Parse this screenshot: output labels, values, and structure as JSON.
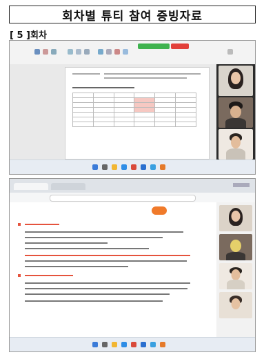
{
  "title": "회차별 튜티 참여 증빙자료",
  "session_label": "[ 5 ]회차",
  "screenshot1": {
    "label": "Document editing session with video call participants",
    "participants": 3
  },
  "screenshot2": {
    "label": "Browser lecture slides with video call participants",
    "participants": 4
  },
  "colors": {
    "green_button": "#3fb34f",
    "red_button": "#e2403a",
    "slide_accent": "#e5533d",
    "badge": "#f07a2a"
  }
}
